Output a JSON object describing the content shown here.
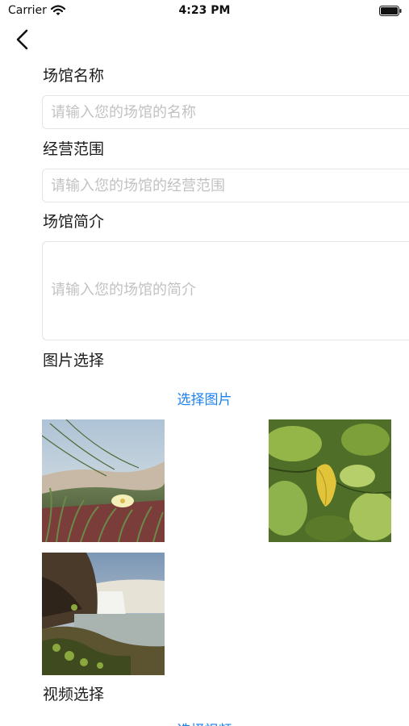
{
  "status_bar": {
    "carrier": "Carrier",
    "time": "4:23 PM",
    "icons": [
      "wifi-icon",
      "battery-icon"
    ]
  },
  "nav": {
    "back_icon": "chevron-left-icon"
  },
  "form": {
    "name": {
      "label": "场馆名称",
      "placeholder": "请输入您的场馆的名称",
      "value": ""
    },
    "scope": {
      "label": "经营范围",
      "placeholder": "请输入您的场馆的经营范围",
      "value": ""
    },
    "intro": {
      "label": "场馆简介",
      "placeholder": "请输入您的场馆的简介",
      "value": ""
    },
    "images": {
      "label": "图片选择",
      "select_label": "选择图片",
      "photos": [
        {
          "name": "photo-beach-flower"
        },
        {
          "name": "photo-leaf"
        },
        {
          "name": "photo-waterfall"
        }
      ]
    },
    "video": {
      "label": "视频选择",
      "select_label": "选择视频"
    }
  },
  "colors": {
    "accent": "#1a82f0",
    "placeholder": "#c2c2c2",
    "border": "#e4e4e4"
  }
}
